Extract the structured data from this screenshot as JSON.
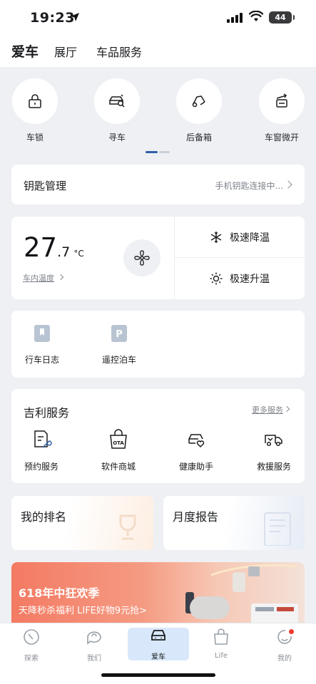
{
  "status_bar": {
    "time": "19:23",
    "battery": "44"
  },
  "top_nav": {
    "tabs": [
      "爱车",
      "展厅",
      "车品服务"
    ]
  },
  "quick_actions": [
    {
      "label": "车锁",
      "icon": "lock-icon"
    },
    {
      "label": "寻车",
      "icon": "find-car-icon"
    },
    {
      "label": "后备箱",
      "icon": "trunk-icon"
    },
    {
      "label": "车窗微开",
      "icon": "window-icon"
    }
  ],
  "key_management": {
    "title": "钥匙管理",
    "status": "手机钥匙连接中..."
  },
  "climate": {
    "temp_int": "27",
    "temp_dec": ".7",
    "unit": "°C",
    "label": "车内温度",
    "cool_label": "极速降温",
    "heat_label": "极速升温"
  },
  "tools": [
    {
      "label": "行车日志",
      "icon": "bookmark-icon"
    },
    {
      "label": "遥控泊车",
      "icon": "parking-icon"
    }
  ],
  "services": {
    "title": "吉利服务",
    "more": "更多服务",
    "items": [
      {
        "label": "预约服务",
        "icon": "appointment-icon"
      },
      {
        "label": "软件商城",
        "icon": "ota-shop-icon"
      },
      {
        "label": "健康助手",
        "icon": "health-car-icon"
      },
      {
        "label": "救援服务",
        "icon": "rescue-truck-icon"
      }
    ]
  },
  "cards": {
    "ranking": "我的排名",
    "report": "月度报告"
  },
  "banner": {
    "title": "618年中狂欢季",
    "subtitle": "天降秒杀福利 LIFE好物9元抢>"
  },
  "bottom_nav": [
    "探索",
    "我们",
    "爱车",
    "Life",
    "我的"
  ],
  "colors": {
    "accent": "#2f5fa8",
    "active_tab_bg": "#d8e8fa",
    "badge": "#ee3a2e"
  }
}
